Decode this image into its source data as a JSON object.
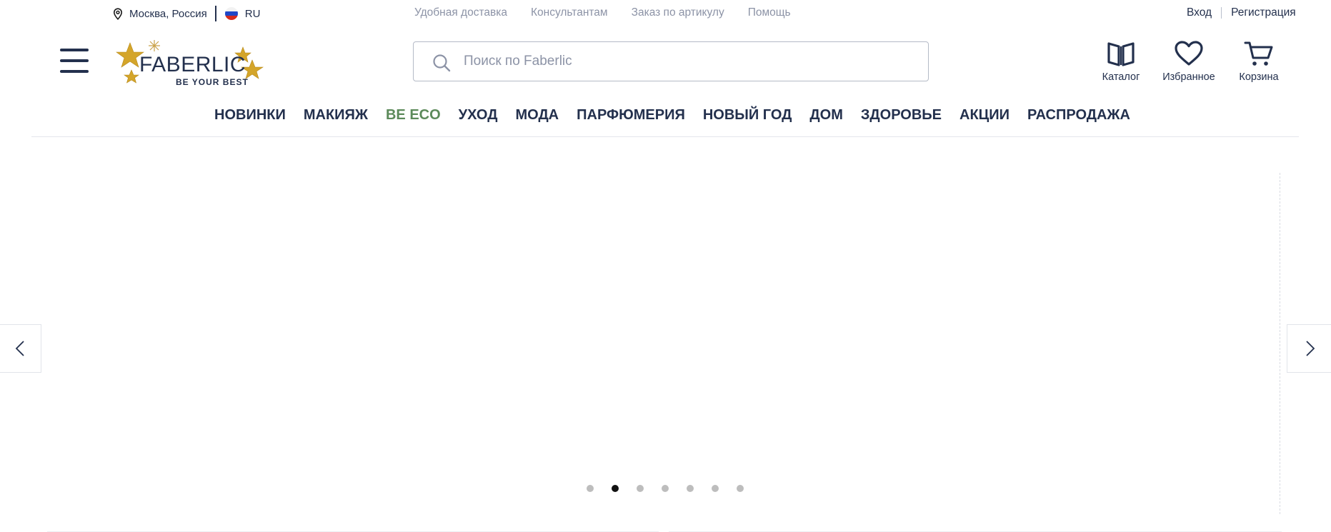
{
  "topbar": {
    "location": "Москва, Россия",
    "language": "RU",
    "links": [
      "Удобная доставка",
      "Консультантам",
      "Заказ по артикулу",
      "Помощь"
    ],
    "login": "Вход",
    "register": "Регистрация"
  },
  "logo": {
    "name": "FABERLIC",
    "tagline": "BE YOUR BEST"
  },
  "search": {
    "placeholder": "Поиск по Faberlic",
    "value": ""
  },
  "header_icons": [
    {
      "label": "Каталог",
      "icon": "book-icon"
    },
    {
      "label": "Избранное",
      "icon": "heart-icon"
    },
    {
      "label": "Корзина",
      "icon": "cart-icon"
    }
  ],
  "nav": [
    "НОВИНКИ",
    "МАКИЯЖ",
    "BE ECO",
    "УХОД",
    "МОДА",
    "ПАРФЮМЕРИЯ",
    "НОВЫЙ ГОД",
    "ДОМ",
    "ЗДОРОВЬЕ",
    "АКЦИИ",
    "РАСПРОДАЖА"
  ],
  "slider": {
    "slide_count": 7,
    "active_slide": 2
  },
  "colors": {
    "primary": "#23304d",
    "muted": "#8c93a6",
    "eco": "#5c8a5a",
    "logo_gold": "#d4a52a"
  }
}
